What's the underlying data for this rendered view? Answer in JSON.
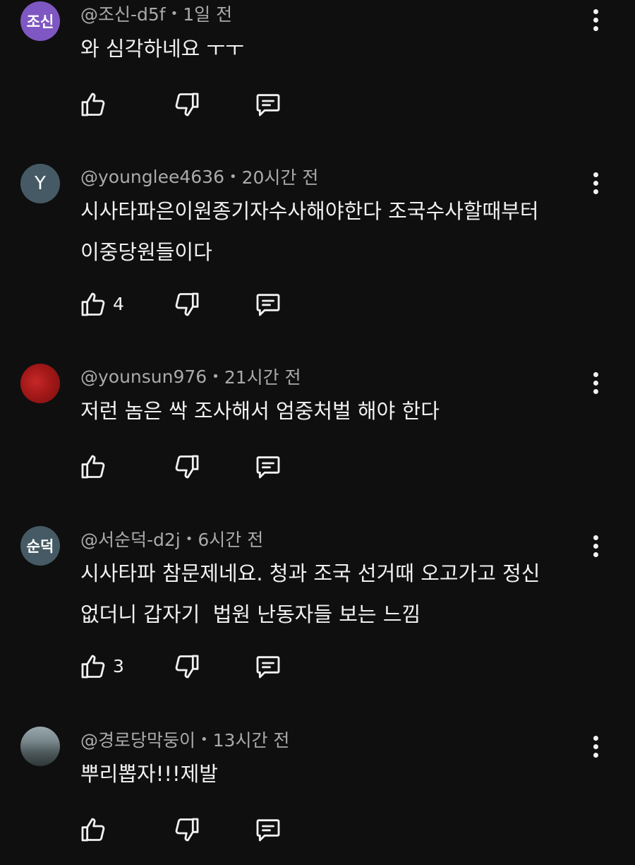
{
  "comments": [
    {
      "handle": "@조신-d5f",
      "separator": "•",
      "time": "1일 전",
      "avatar_text": "조신",
      "avatar_color": "#7e57c2",
      "lines": [
        "와 심각하네요 ㅜㅜ"
      ],
      "likes": ""
    },
    {
      "handle": "@younglee4636",
      "separator": "•",
      "time": "20시간 전",
      "avatar_text": "Y",
      "avatar_color": "#455a64",
      "lines": [
        "시사타파은이원종기자수사해야한다 조국수사할때부터",
        "이중당원들이다"
      ],
      "likes": "4"
    },
    {
      "handle": "@younsun976",
      "separator": "•",
      "time": "21시간 전",
      "avatar_text": "",
      "avatar_color": "#b71c1c",
      "lines": [
        "저런 놈은 싹 조사해서 엄중처벌 해야 한다"
      ],
      "likes": ""
    },
    {
      "handle": "@서순덕-d2j",
      "separator": "•",
      "time": "6시간 전",
      "avatar_text": "순덕",
      "avatar_color": "#455a64",
      "lines": [
        "시사타파 참문제네요. 청과 조국 선거때 오고가고 정신",
        "없더니 갑자기  법원 난동자들 보는 느낌"
      ],
      "likes": "3"
    },
    {
      "handle": "@경로당막둥이",
      "separator": "•",
      "time": "13시간 전",
      "avatar_text": "",
      "avatar_color": "#5d6b6e",
      "lines": [
        "뿌리뽑자!!!제발"
      ],
      "likes": ""
    }
  ]
}
